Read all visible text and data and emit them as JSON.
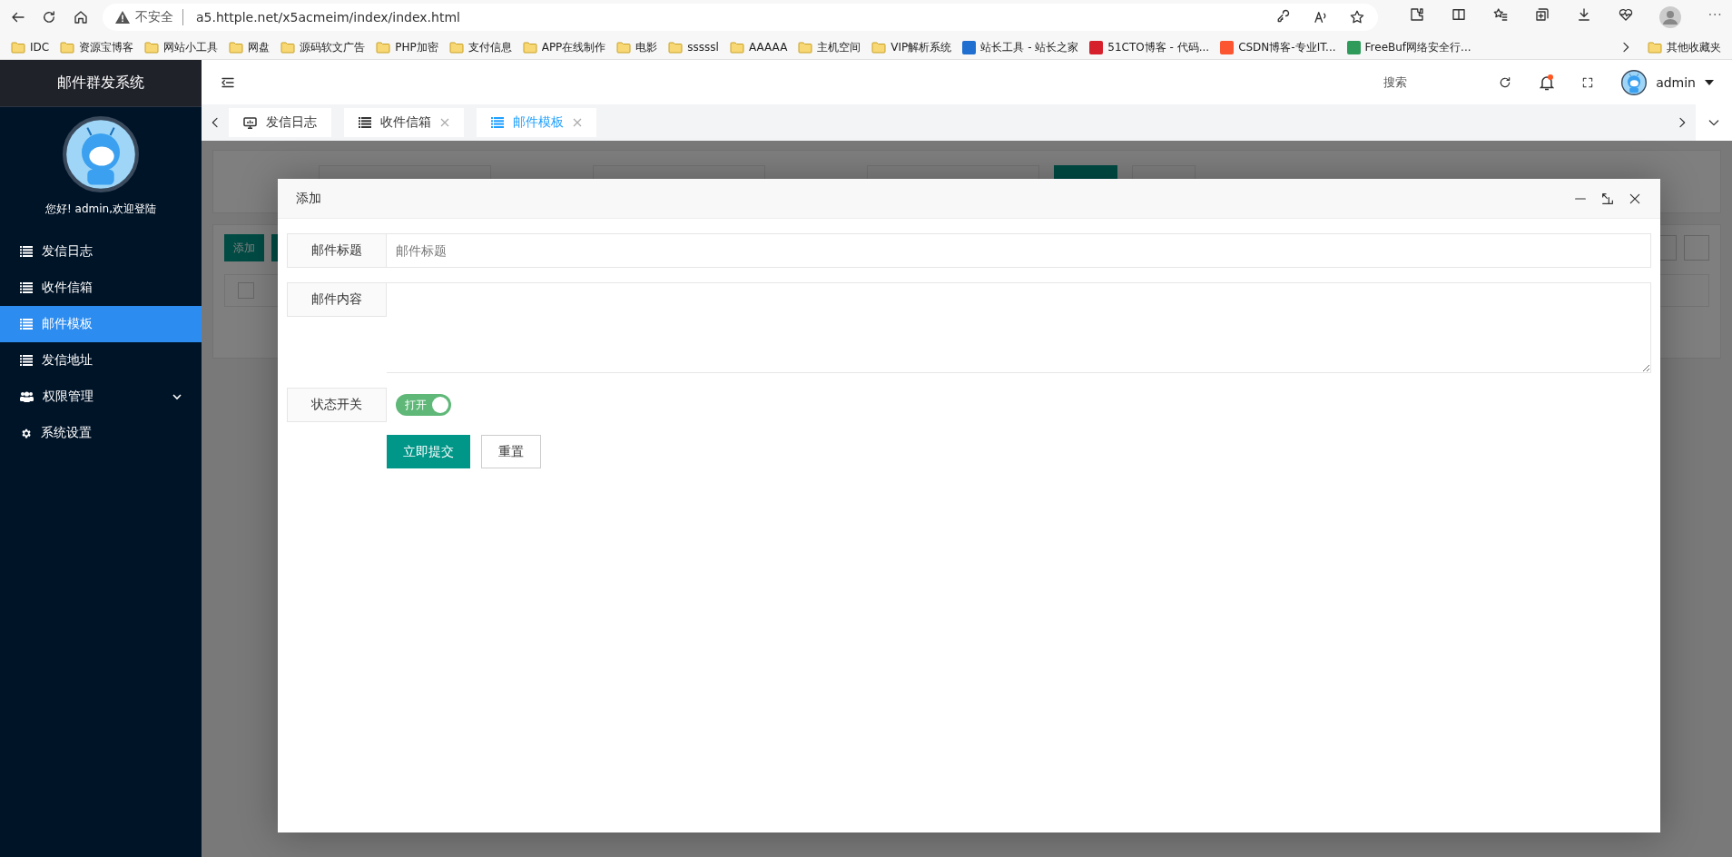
{
  "browser": {
    "security": "不安全",
    "url": "a5.httple.net/x5acmeim/index/index.html",
    "bookmarks": [
      {
        "label": "IDC",
        "kind": "folder"
      },
      {
        "label": "资源宝博客",
        "kind": "folder"
      },
      {
        "label": "网站小工具",
        "kind": "folder"
      },
      {
        "label": "网盘",
        "kind": "folder"
      },
      {
        "label": "源码软文广告",
        "kind": "folder"
      },
      {
        "label": "PHP加密",
        "kind": "folder"
      },
      {
        "label": "支付信息",
        "kind": "folder"
      },
      {
        "label": "APP在线制作",
        "kind": "folder"
      },
      {
        "label": "电影",
        "kind": "folder"
      },
      {
        "label": "sssssl",
        "kind": "folder"
      },
      {
        "label": "AAAAA",
        "kind": "folder"
      },
      {
        "label": "主机空间",
        "kind": "folder"
      },
      {
        "label": "VIP解析系统",
        "kind": "folder"
      },
      {
        "label": "站长工具 - 站长之家",
        "kind": "site",
        "color": "#1e6fd0"
      },
      {
        "label": "51CTO博客 - 代码...",
        "kind": "site",
        "color": "#d6202b"
      },
      {
        "label": "CSDN博客-专业IT...",
        "kind": "site",
        "color": "#fc5531"
      },
      {
        "label": "FreeBuf网络安全行...",
        "kind": "site",
        "color": "#2e9b5b"
      }
    ],
    "other_bookmarks": "其他收藏夹"
  },
  "sidebar": {
    "title": "邮件群发系统",
    "welcome": "您好! admin,欢迎登陆",
    "menu": [
      {
        "label": "发信日志",
        "kind": "list",
        "selected": false
      },
      {
        "label": "收件信箱",
        "kind": "list",
        "selected": false
      },
      {
        "label": "邮件模板",
        "kind": "list",
        "selected": true
      },
      {
        "label": "发信地址",
        "kind": "list",
        "selected": false
      },
      {
        "label": "权限管理",
        "kind": "users",
        "selected": false,
        "expandable": true
      },
      {
        "label": "系统设置",
        "kind": "gear",
        "selected": false
      }
    ]
  },
  "header": {
    "search": "搜索",
    "user": "admin"
  },
  "tabs": [
    {
      "label": "发信日志",
      "kind": "monitor",
      "closable": false,
      "selected": false
    },
    {
      "label": "收件信箱",
      "kind": "list",
      "closable": true,
      "selected": false
    },
    {
      "label": "邮件模板",
      "kind": "list",
      "closable": true,
      "selected": true
    }
  ],
  "background": {
    "add_button": "添加",
    "select_all_checked": false
  },
  "modal": {
    "title": "添加",
    "fields": [
      {
        "label": "邮件标题",
        "kind": "input",
        "placeholder": "邮件标题"
      },
      {
        "label": "邮件内容",
        "kind": "textarea"
      },
      {
        "label": "状态开关",
        "kind": "switch",
        "on": true,
        "switch_text": "打开"
      }
    ],
    "submit": "立即提交",
    "reset": "重置"
  }
}
